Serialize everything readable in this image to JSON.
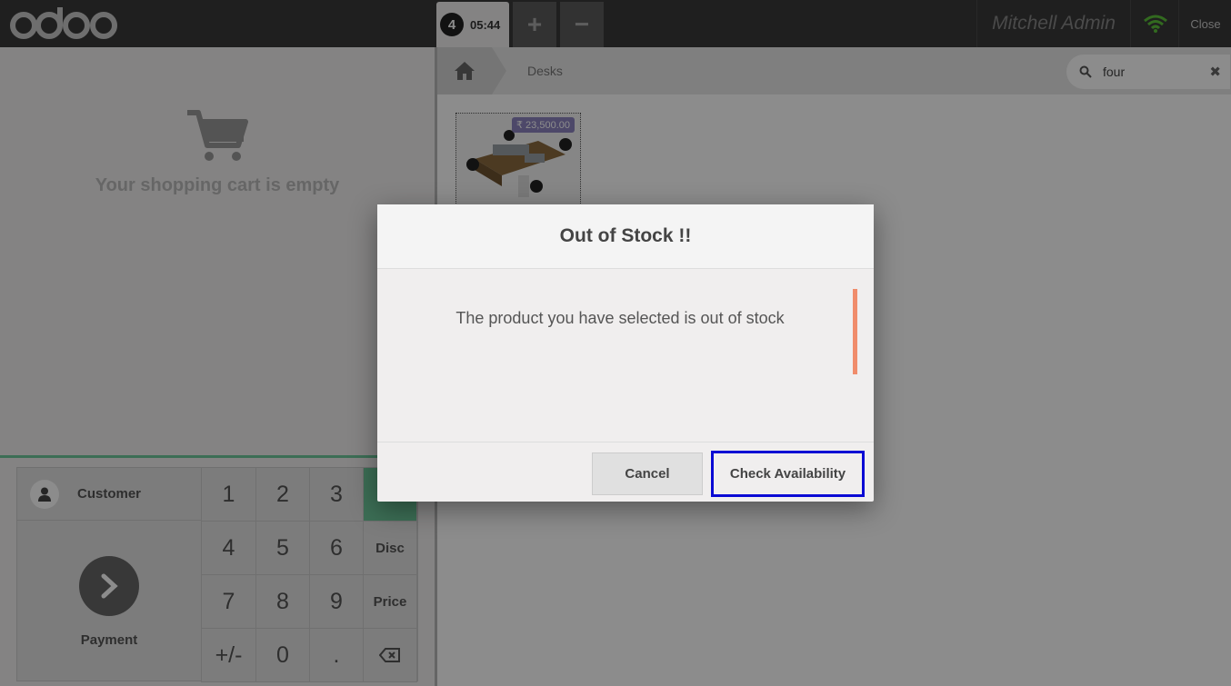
{
  "header": {
    "logo": "odoo",
    "order_number": "4",
    "order_time": "05:44",
    "add_order_label": "+",
    "remove_order_label": "−",
    "user_name": "Mitchell Admin",
    "wifi_icon": "wifi-icon",
    "close_label": "Close"
  },
  "cart": {
    "empty_text": "Your shopping cart is empty"
  },
  "controls": {
    "customer_label": "Customer",
    "payment_label": "Payment",
    "keys": [
      "1",
      "2",
      "3",
      "",
      "4",
      "5",
      "6",
      "Disc",
      "7",
      "8",
      "9",
      "Price",
      "+/-",
      "0",
      ".",
      "⌫"
    ]
  },
  "products": {
    "breadcrumb_category": "Desks",
    "search_value": "four",
    "items": [
      {
        "price": "₹ 23,500.00"
      }
    ]
  },
  "dialog": {
    "title": "Out of Stock !!",
    "message": "The product you have selected is out of stock",
    "cancel_label": "Cancel",
    "check_label": "Check Availability"
  },
  "colors": {
    "accent_green": "#6ec89b",
    "warning_bar": "#f08c6b",
    "focus_outline": "#0a0ad4",
    "price_tag": "#8c84c0"
  }
}
